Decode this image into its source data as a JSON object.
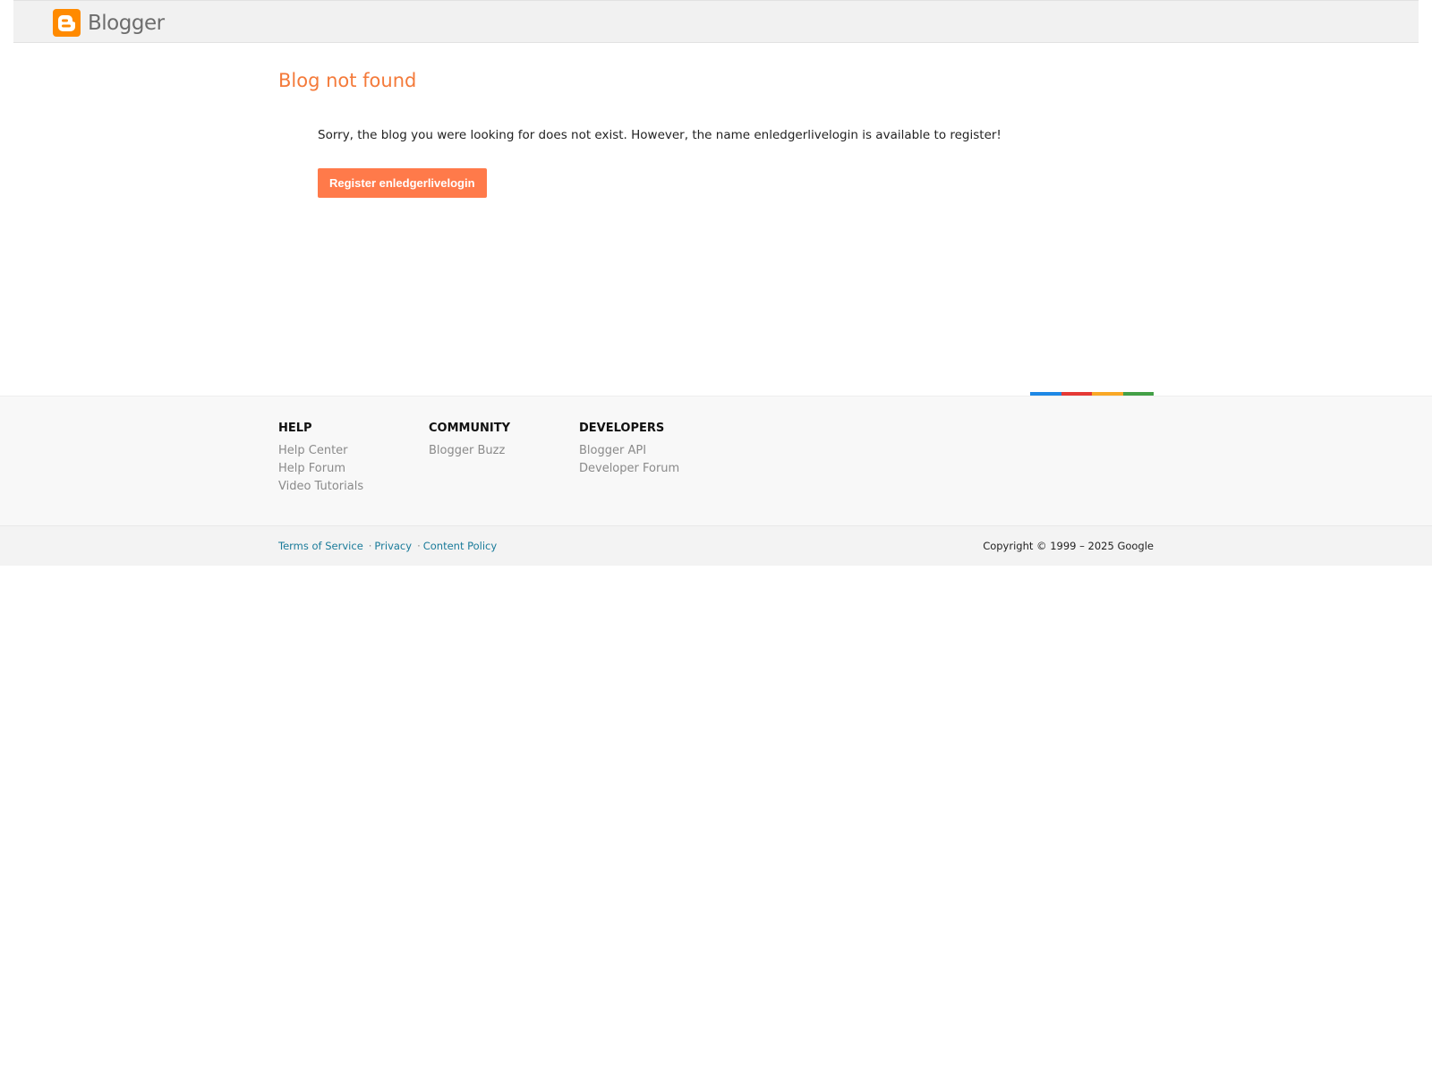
{
  "header": {
    "logo_text": "Blogger",
    "logo_icon": "blogger-b-icon"
  },
  "main": {
    "title": "Blog not found",
    "message": "Sorry, the blog you were looking for does not exist. However, the name enledgerlivelogin is available to register!",
    "register_button": "Register enledgerlivelogin"
  },
  "colors": {
    "accent": "#f47a3a",
    "button": "#ff7a4a",
    "strip": [
      "#1e88e5",
      "#e53935",
      "#f9a825",
      "#43a047"
    ]
  },
  "footer": {
    "columns": [
      {
        "heading": "HELP",
        "links": [
          "Help Center",
          "Help Forum",
          "Video Tutorials"
        ]
      },
      {
        "heading": "COMMUNITY",
        "links": [
          "Blogger Buzz"
        ]
      },
      {
        "heading": "DEVELOPERS",
        "links": [
          "Blogger API",
          "Developer Forum"
        ]
      }
    ]
  },
  "bottom": {
    "terms": "Terms of Service",
    "privacy": "Privacy",
    "content_policy": "Content Policy",
    "separator": "·",
    "copyright": "Copyright © 1999 – 2025 Google"
  }
}
